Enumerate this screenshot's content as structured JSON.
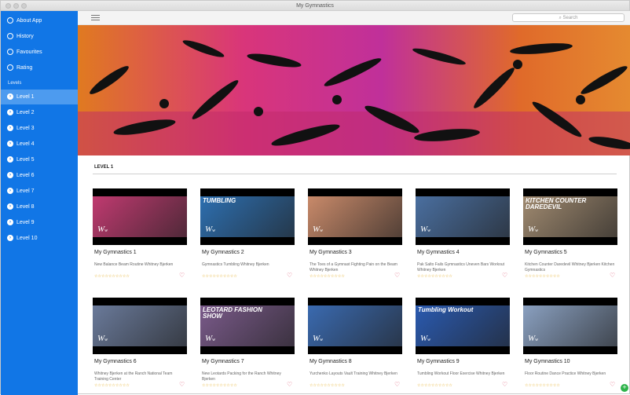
{
  "window": {
    "title": "My Gymnastics"
  },
  "sidebar": {
    "top_items": [
      {
        "label": "About App",
        "icon": "info-icon"
      },
      {
        "label": "History",
        "icon": "clock-icon"
      },
      {
        "label": "Favourites",
        "icon": "heart-icon"
      },
      {
        "label": "Rating",
        "icon": "star-icon"
      }
    ],
    "section_label": "Levels",
    "levels": [
      {
        "label": "Level 1",
        "active": true
      },
      {
        "label": "Level 2"
      },
      {
        "label": "Level 3"
      },
      {
        "label": "Level 4"
      },
      {
        "label": "Level 5"
      },
      {
        "label": "Level 6"
      },
      {
        "label": "Level 7"
      },
      {
        "label": "Level 8"
      },
      {
        "label": "Level 9"
      },
      {
        "label": "Level 10"
      }
    ]
  },
  "toolbar": {
    "search_placeholder": "Search"
  },
  "main": {
    "section_title": "LEVEL 1",
    "videos": [
      {
        "title": "My Gymnastics 1",
        "desc": "New Balance Beam Routine  Whitney Bjerken",
        "thumb_text": "",
        "thumb_color": "#c03a70"
      },
      {
        "title": "My Gymnastics 2",
        "desc": "Gymnastics Tumbling  Whitney Bjerken",
        "thumb_text": "TUMBLING",
        "thumb_color": "#2d6fb0"
      },
      {
        "title": "My Gymnastics 3",
        "desc": "The Toes of a Gymnast  Fighting Pain on the Beam  Whitney Bjerken",
        "thumb_text": "",
        "thumb_color": "#c98a6a"
      },
      {
        "title": "My Gymnastics 4",
        "desc": "Pak Salto Fails  Gymnastics Uneven Bars Workout  Whitney Bjerken",
        "thumb_text": "",
        "thumb_color": "#4a6fa0"
      },
      {
        "title": "My Gymnastics 5",
        "desc": "Kitchen Counter Daredevil  Whitney Bjerken Kitchen Gymnastics",
        "thumb_text": "KITCHEN COUNTER DAREDEVIL",
        "thumb_color": "#a08a70"
      },
      {
        "title": "My Gymnastics 6",
        "desc": "Whitney Bjerken at the Ranch  National Team Training Center",
        "thumb_text": "",
        "thumb_color": "#6a7a9a"
      },
      {
        "title": "My Gymnastics 7",
        "desc": "New Leotards  Packing for the Ranch  Whitney Bjerken",
        "thumb_text": "LEOTARD FASHION SHOW",
        "thumb_color": "#7a5a8a"
      },
      {
        "title": "My Gymnastics 8",
        "desc": "Yurchenko Layouts  Vault Training  Whitney Bjerken",
        "thumb_text": "",
        "thumb_color": "#3a6ab0"
      },
      {
        "title": "My Gymnastics 9",
        "desc": "Tumbling Workout  Floor Exercise  Whitney Bjerken",
        "thumb_text": "Tumbling Workout",
        "thumb_color": "#2a5ab0"
      },
      {
        "title": "My Gymnastics 10",
        "desc": "Floor Routine  Dance Practice  Whitney Bjerken",
        "thumb_text": "",
        "thumb_color": "#8aa0c0"
      }
    ],
    "rating_stars": "☆☆☆☆☆☆☆☆☆☆"
  },
  "colors": {
    "sidebar": "#1176e6",
    "active_item": "#4d9bef",
    "heart": "#e0607a",
    "stars": "#e0a000"
  }
}
